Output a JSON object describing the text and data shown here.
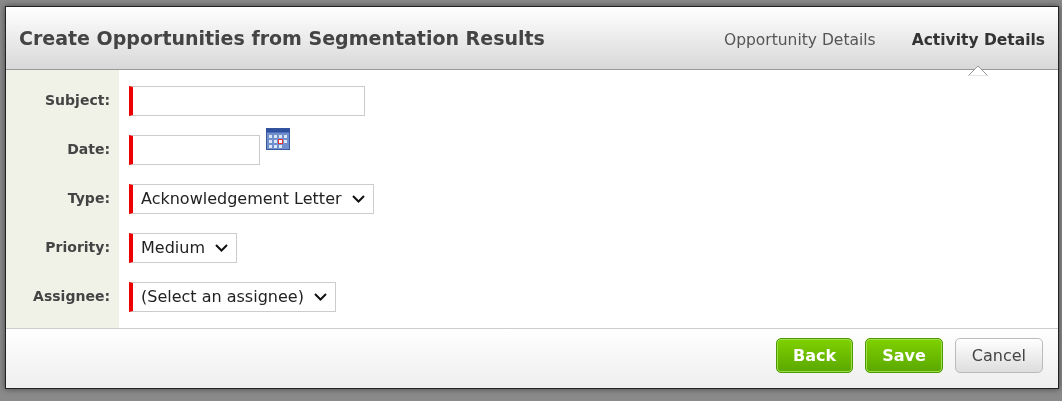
{
  "dialog": {
    "title": "Create Opportunities from Segmentation Results",
    "tabs": [
      {
        "label": "Opportunity Details",
        "selected": false
      },
      {
        "label": "Activity Details",
        "selected": true
      }
    ],
    "fields": [
      {
        "label": "Subject:",
        "kind": "text",
        "required": true
      },
      {
        "label": "Date:",
        "kind": "date",
        "required": true
      },
      {
        "label": "Type:",
        "kind": "select",
        "value": "Acknowledgement Letter",
        "required": true
      },
      {
        "label": "Priority:",
        "kind": "select",
        "value": "Medium",
        "required": true
      },
      {
        "label": "Assignee:",
        "kind": "select",
        "value": "(Select an assignee)",
        "required": true
      }
    ],
    "buttons": [
      {
        "label": "Back",
        "kind": "primary"
      },
      {
        "label": "Save",
        "kind": "primary"
      },
      {
        "label": "Cancel",
        "kind": "secondary"
      }
    ]
  }
}
